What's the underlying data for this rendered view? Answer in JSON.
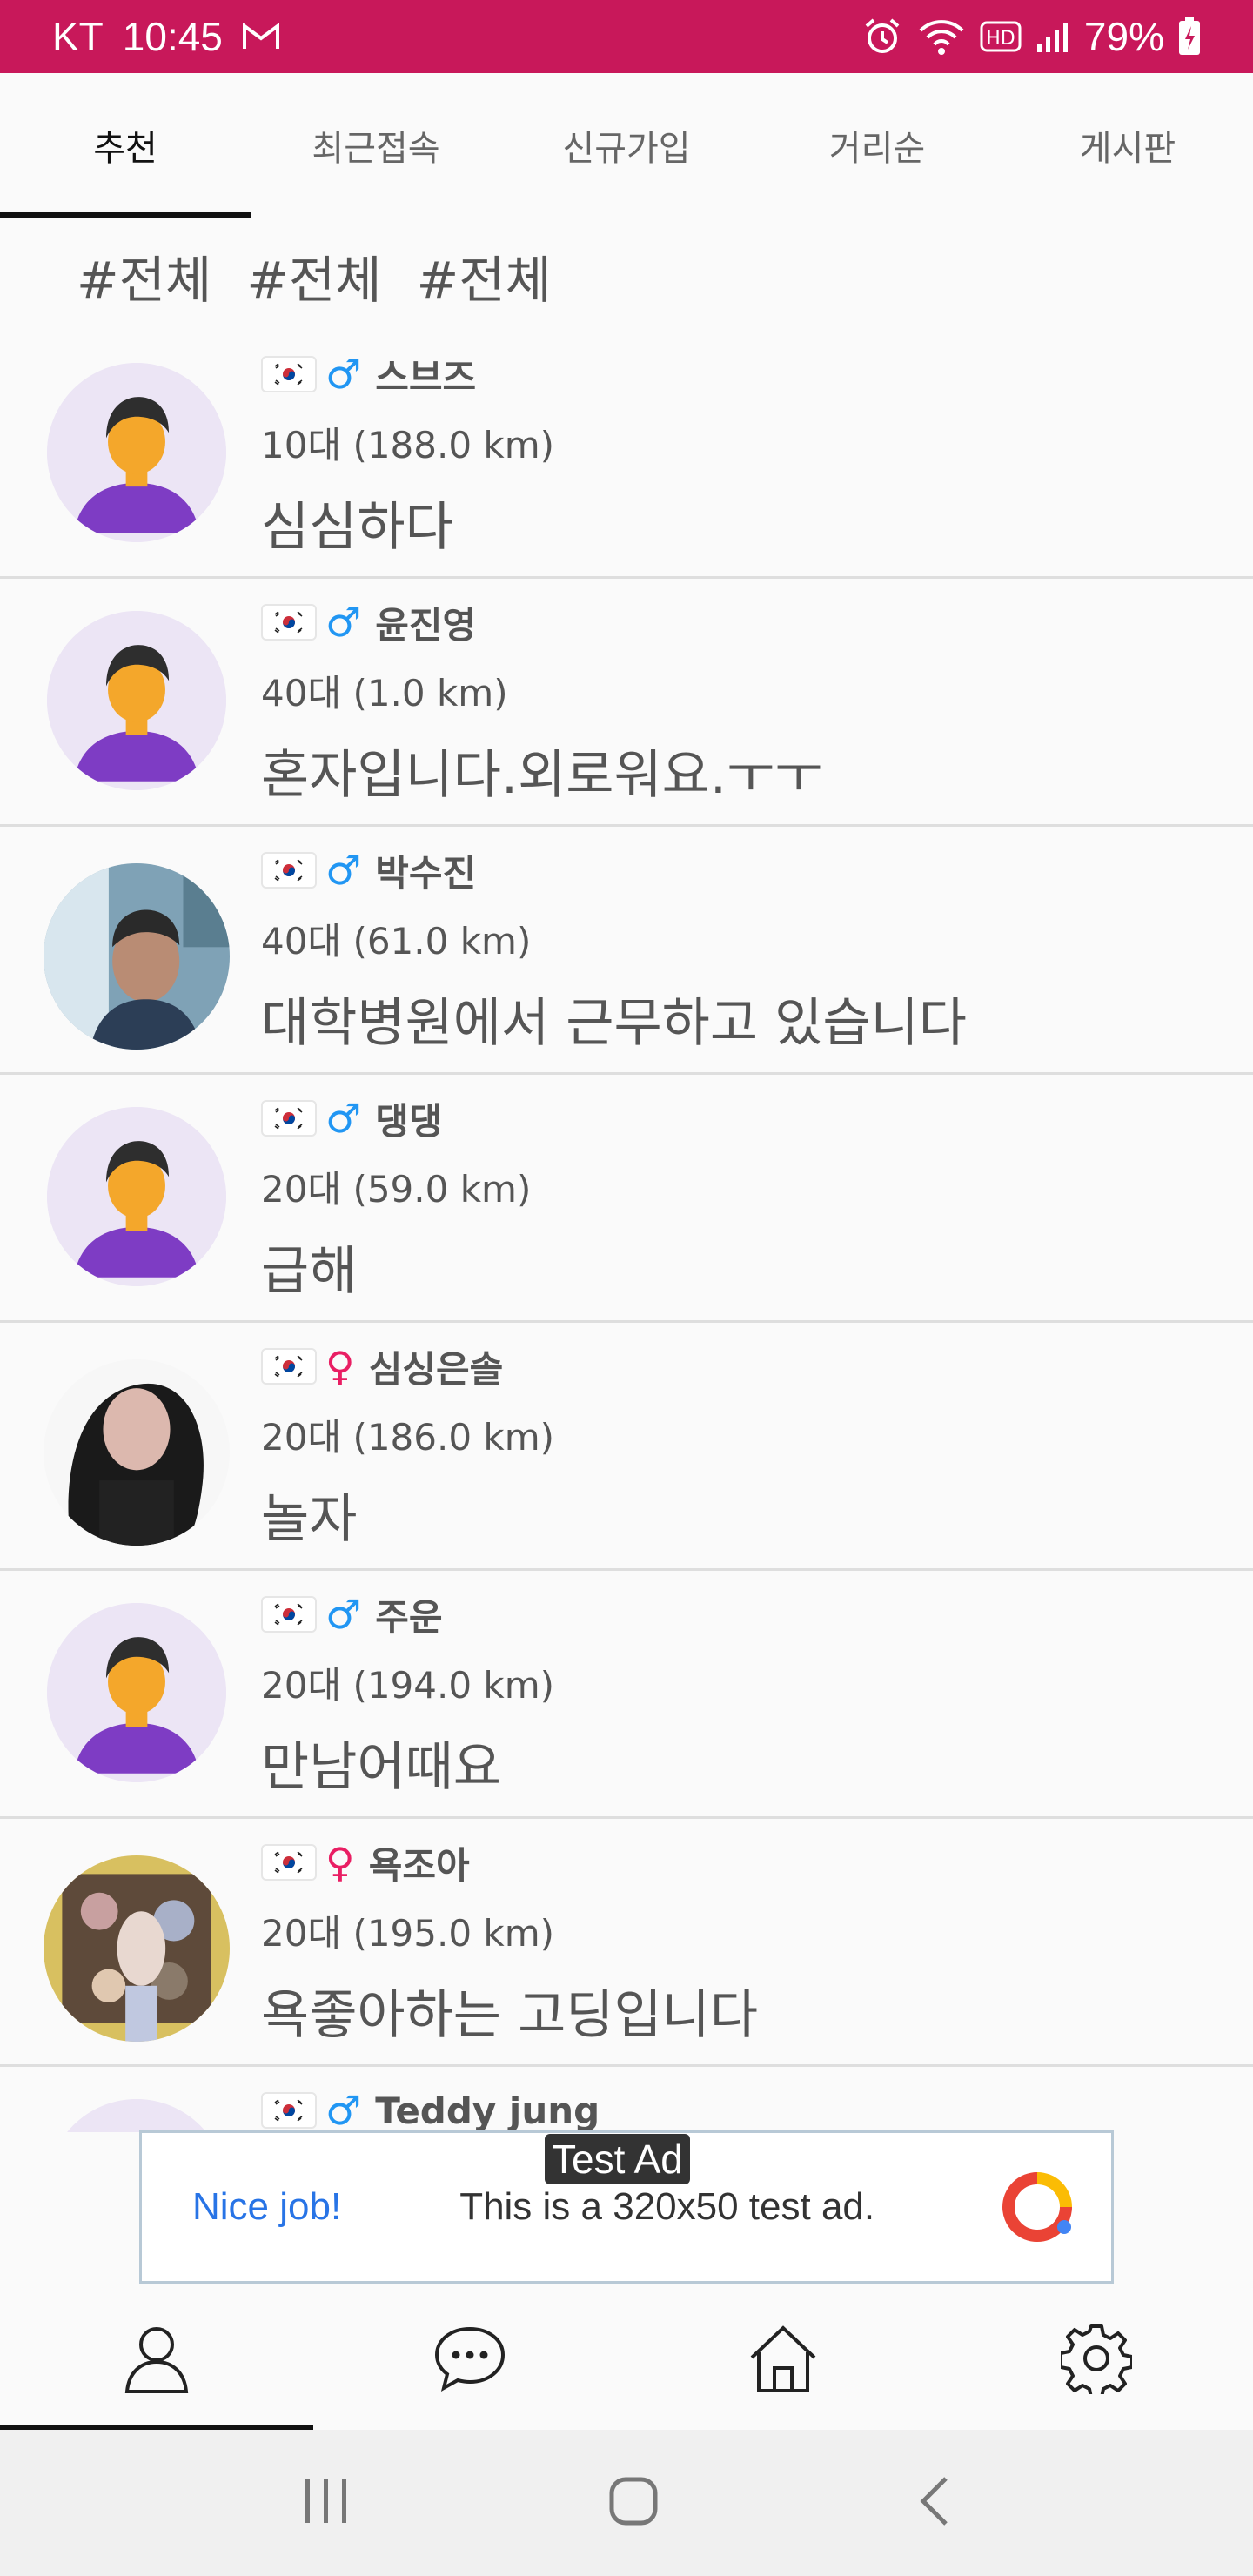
{
  "status_bar": {
    "carrier": "KT",
    "time": "10:45",
    "battery": "79%",
    "icons": [
      "gmail-icon",
      "alarm-icon",
      "wifi-icon",
      "hd-icon",
      "signal-icon",
      "battery-icon"
    ]
  },
  "tabs": [
    {
      "label": "추천",
      "active": true
    },
    {
      "label": "최근접속",
      "active": false
    },
    {
      "label": "신규가입",
      "active": false
    },
    {
      "label": "거리순",
      "active": false
    },
    {
      "label": "게시판",
      "active": false
    }
  ],
  "hashtags": [
    "#전체",
    "#전체",
    "#전체"
  ],
  "users": [
    {
      "nickname": "스브즈",
      "gender": "♂",
      "age": "10대",
      "distance": "(188.0 km)",
      "message": "심심하다",
      "avatar": "default-avatar-icon"
    },
    {
      "nickname": "윤진영",
      "gender": "♂",
      "age": "40대",
      "distance": "(1.0 km)",
      "message": "혼자입니다.외로워요.ㅜㅜ",
      "avatar": "default-avatar-icon"
    },
    {
      "nickname": "박수진",
      "gender": "♂",
      "age": "40대",
      "distance": "(61.0 km)",
      "message": "대학병원에서 근무하고 있습니다",
      "avatar": "photo"
    },
    {
      "nickname": "댕댕",
      "gender": "♂",
      "age": "20대",
      "distance": "(59.0 km)",
      "message": "급해",
      "avatar": "default-avatar-icon"
    },
    {
      "nickname": "심싱은솔",
      "gender": "♀",
      "age": "20대",
      "distance": "(186.0 km)",
      "message": "놀자",
      "avatar": "photo"
    },
    {
      "nickname": "주운",
      "gender": "♂",
      "age": "20대",
      "distance": "(194.0 km)",
      "message": "만남어때요",
      "avatar": "default-avatar-icon"
    },
    {
      "nickname": "욕조아",
      "gender": "♀",
      "age": "20대",
      "distance": "(195.0 km)",
      "message": "욕좋아하는 고딩입니다",
      "avatar": "photo"
    },
    {
      "nickname": "Teddy jung",
      "gender": "♂",
      "age": "",
      "distance": "",
      "message": "",
      "avatar": "default-avatar-icon"
    }
  ],
  "ad": {
    "badge": "Test Ad",
    "headline": "Nice job!",
    "text": "This is a 320x50 test ad."
  },
  "bottom_nav": [
    "person-icon",
    "chat-icon",
    "home-icon",
    "gear-icon"
  ],
  "colors": {
    "accent": "#c8185a",
    "male": "#2196f3",
    "female": "#e91e63"
  }
}
